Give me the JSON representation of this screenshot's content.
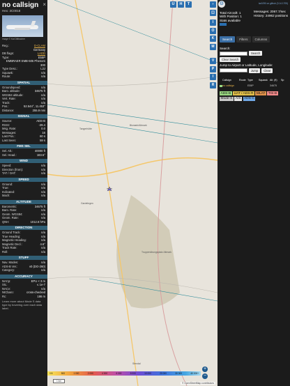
{
  "aircraft": {
    "callsign": "no callsign",
    "hex": "Hex: 3C0018",
    "photo_credit": "Image © Kai Dittbacher",
    "general": [
      {
        "k": "Reg.:",
        "v": "D-CLAM",
        "link": true
      },
      {
        "k": "",
        "v": "Germany"
      },
      {
        "k": "DB flags:",
        "v": "LADD",
        "link": true
      },
      {
        "k": "Type:",
        "v": "E55P"
      },
      {
        "k": "",
        "v": "EMBRAER EMB-505 Phenom 300"
      },
      {
        "k": "Type Desc.:",
        "v": "L2J"
      },
      {
        "k": "Squawk:",
        "v": "n/a"
      },
      {
        "k": "Route:",
        "v": "n/a"
      }
    ],
    "sections": [
      {
        "title": "SPATIAL",
        "rows": [
          {
            "k": "Groundspeed:",
            "v": "n/a"
          },
          {
            "k": "Baro. altitude:",
            "v": "34675 ft"
          },
          {
            "k": "WGS84 altitude:",
            "v": "n/a"
          },
          {
            "k": "Vert. Rate:",
            "v": "n/a"
          },
          {
            "k": "Track:",
            "v": "n/a"
          },
          {
            "k": "Pos.:",
            "v": "52.544°, 11.453°"
          },
          {
            "k": "Distance:",
            "v": "255.9 nmi"
          }
        ]
      },
      {
        "title": "SIGNAL",
        "rows": [
          {
            "k": "Source:",
            "v": "ADS-B"
          },
          {
            "k": "RSSI:",
            "v": "-29.4"
          },
          {
            "k": "Msg. Rate:",
            "v": "0.0"
          },
          {
            "k": "Messages:",
            "v": "16"
          },
          {
            "k": "Last Pos.:",
            "v": "60 s"
          },
          {
            "k": "Last Seen:",
            "v": "59 s"
          }
        ]
      },
      {
        "title": "FMS SEL",
        "rows": [
          {
            "k": "Sel. Alt.:",
            "v": "40000 ft"
          },
          {
            "k": "Sel. Head.:",
            "v": "183.5°"
          }
        ]
      },
      {
        "title": "WIND",
        "rows": [
          {
            "k": "Speed:",
            "v": "n/a"
          },
          {
            "k": "Direction (from):",
            "v": "n/a"
          },
          {
            "k": "TAT / OAT:",
            "v": "n/a"
          }
        ]
      },
      {
        "title": "SPEED",
        "rows": [
          {
            "k": "Ground:",
            "v": "n/a"
          },
          {
            "k": "True:",
            "v": "n/a"
          },
          {
            "k": "Indicated:",
            "v": "n/a"
          },
          {
            "k": "Mach:",
            "v": "n/a"
          }
        ]
      },
      {
        "title": "ALTITUDE",
        "rows": [
          {
            "k": "Barometric:",
            "v": "34675 ft"
          },
          {
            "k": "Baro. Rate:",
            "v": "n/a"
          },
          {
            "k": "Geom. WGS84:",
            "v": "n/a"
          },
          {
            "k": "Geom. Rate:",
            "v": "n/a"
          },
          {
            "k": "QNH:",
            "v": "1012.8 hPa"
          }
        ]
      },
      {
        "title": "DIRECTION",
        "rows": [
          {
            "k": "Ground Track:",
            "v": "n/a"
          },
          {
            "k": "True Heading:",
            "v": "n/a"
          },
          {
            "k": "Magnetic Heading:",
            "v": "n/a"
          },
          {
            "k": "Magnetic Decl.:",
            "v": "4.6°"
          },
          {
            "k": "Track Rate:",
            "v": "n/a"
          },
          {
            "k": "Roll:",
            "v": "n/a"
          }
        ]
      },
      {
        "title": "STUFF",
        "rows": [
          {
            "k": "Nav. Modes:",
            "v": "n/a"
          },
          {
            "k": "ADS-B Ver.:",
            "v": "v0 (DO-260)"
          },
          {
            "k": "Category:",
            "v": "n/a"
          }
        ]
      },
      {
        "title": "ACCURACY",
        "rows": [
          {
            "k": "NACp:",
            "v": "EPU < 3 m"
          },
          {
            "k": "SIL:",
            "v": "≤ 1e-7"
          },
          {
            "k": "NACv:",
            "v": "n/a"
          },
          {
            "k": "NICbaro:",
            "v": "cross-checked"
          },
          {
            "k": "Rc:",
            "v": "186 m"
          }
        ]
      }
    ],
    "note": "Learn more about Mode S data type by hovering over each data label."
  },
  "map": {
    "buttons": [
      "U",
      "H",
      "T"
    ],
    "side_buttons": [
      "I",
      "O",
      "K",
      "M",
      "V",
      "P",
      "I",
      "R"
    ],
    "places": [
      "Bismark/Altmark",
      "Tangerhütte",
      "Gardelegen",
      "Truppenübungsplatz Altmark",
      "Stendal"
    ],
    "scale_labels": [
      "0 ft",
      "500",
      "1 000",
      "2 000",
      "4 000",
      "6 000",
      "8 000",
      "10 000",
      "20 000",
      "30 000",
      "40 000+"
    ],
    "map_scale": "1 km",
    "attribution": "© OpenStreetMap contributors",
    "zoom_in": "+",
    "zoom_out": "−",
    "colors": {
      "land": "#eae7df",
      "aircraft": "#6b5fd6",
      "track_line": "#2f8c9a"
    }
  },
  "sidebar": {
    "version": "tar1090 on github (3.14.1705)",
    "stats": [
      {
        "k": "Total Aircraft:",
        "v": "1"
      },
      {
        "k": "With Position:",
        "v": "1"
      },
      {
        "k": "Stats available",
        "v": ""
      }
    ],
    "messages": "Messages: 2067.7/sec",
    "history": "History: 24962 positions",
    "tabs": [
      "Search",
      "Filters",
      "Columns"
    ],
    "search_label": "Search:",
    "search_button": "Search",
    "clear_search": "Clear Search",
    "jump_label": "Jump to Airport or Latitude, Longitude:",
    "jump_button": "Jump",
    "clear_button": "Clear",
    "table_columns": [
      "Callsign",
      "Route",
      "Type",
      "Squawk",
      "Alt. (ft)",
      "Sp"
    ],
    "table_rows": [
      {
        "callsign": "no callsign",
        "route": "",
        "type": "E55P",
        "squawk": "",
        "alt": "34675"
      }
    ],
    "legend": [
      {
        "label": "ADS-B",
        "color": "#9ad982"
      },
      {
        "label": "UAT / ADS-R",
        "color": "#e3c04a"
      },
      {
        "label": "MLAT",
        "color": "#e0924a"
      },
      {
        "label": "TIS-B",
        "color": "#f18a8a"
      },
      {
        "label": "Mode-S",
        "color": "#c9c9c9"
      },
      {
        "label": "AIS",
        "color": "#e5e5e5"
      },
      {
        "label": "ADS-C",
        "color": "#70a8e6"
      }
    ]
  }
}
